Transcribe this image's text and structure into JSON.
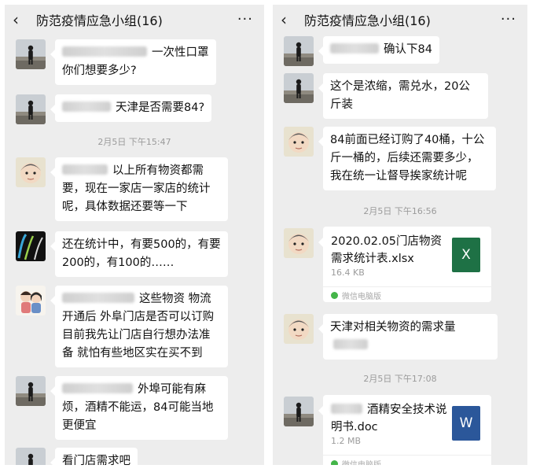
{
  "left": {
    "header": {
      "back_icon": "‹",
      "title": "防范疫情应急小组(16)",
      "more_icon": "···"
    },
    "messages": [
      {
        "avatar": "person-landscape",
        "text": "一次性口罩你们想要多少?"
      },
      {
        "avatar": "person-landscape",
        "text": "天津是否需要84?"
      },
      {
        "type": "time",
        "text": "2月5日 下午15:47"
      },
      {
        "avatar": "baby",
        "text": "以上所有物资都需要，现在一家店一家店的统计呢，具体数据还要等一下"
      },
      {
        "avatar": "dark-abstract",
        "text": "还在统计中，有要500的，有要200的，有100的……"
      },
      {
        "avatar": "cartoon-couple",
        "text": "这些物资 物流开通后 外阜门店是否可以订购 目前我先让门店自行想办法准备 就怕有些地区实在买不到"
      },
      {
        "avatar": "person-landscape",
        "text": "外埠可能有麻烦，酒精不能运，84可能当地更便宜"
      },
      {
        "avatar": "person-landscape",
        "text": "看门店需求吧"
      }
    ]
  },
  "right": {
    "header": {
      "back_icon": "‹",
      "title": "防范疫情应急小组(16)",
      "more_icon": "···"
    },
    "messages": [
      {
        "avatar": "person-landscape",
        "text": "确认下84"
      },
      {
        "avatar": "person-landscape",
        "text": "这个是浓缩，需兑水，20公斤装"
      },
      {
        "avatar": "baby",
        "text": "84前面已经订购了40桶，十公斤一桶的，后续还需要多少，我在统一让督导挨家统计呢"
      },
      {
        "type": "time",
        "text": "2月5日 下午16:56"
      },
      {
        "avatar": "baby",
        "type": "file",
        "file_name": "2020.02.05门店物资需求统计表.xlsx",
        "file_size": "16.4 KB",
        "file_icon": "X",
        "icon_color": "#1e7145",
        "source": "微信电脑版"
      },
      {
        "avatar": "baby",
        "text": "天津对相关物资的需求量"
      },
      {
        "type": "time",
        "text": "2月5日 下午17:08"
      },
      {
        "avatar": "person-landscape",
        "type": "file",
        "file_name": "酒精安全技术说明书.doc",
        "file_size": "1.2 MB",
        "file_icon": "W",
        "icon_color": "#2b579a",
        "source": "微信电脑版"
      }
    ]
  }
}
